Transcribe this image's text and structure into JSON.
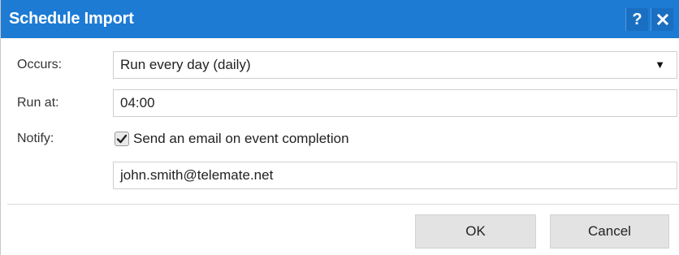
{
  "window": {
    "title": "Schedule Import",
    "help_label": "?",
    "close_icon": "close-icon",
    "accent_color": "#1d7bd4"
  },
  "form": {
    "occurs": {
      "label": "Occurs:",
      "value": "Run every day (daily)",
      "arrow": "▼"
    },
    "run_at": {
      "label": "Run at:",
      "value": "04:00"
    },
    "notify": {
      "label": "Notify:",
      "checkbox_label": "Send an email on event completion",
      "checked": true,
      "email": "john.smith@telemate.net"
    }
  },
  "buttons": {
    "ok": "OK",
    "cancel": "Cancel"
  }
}
